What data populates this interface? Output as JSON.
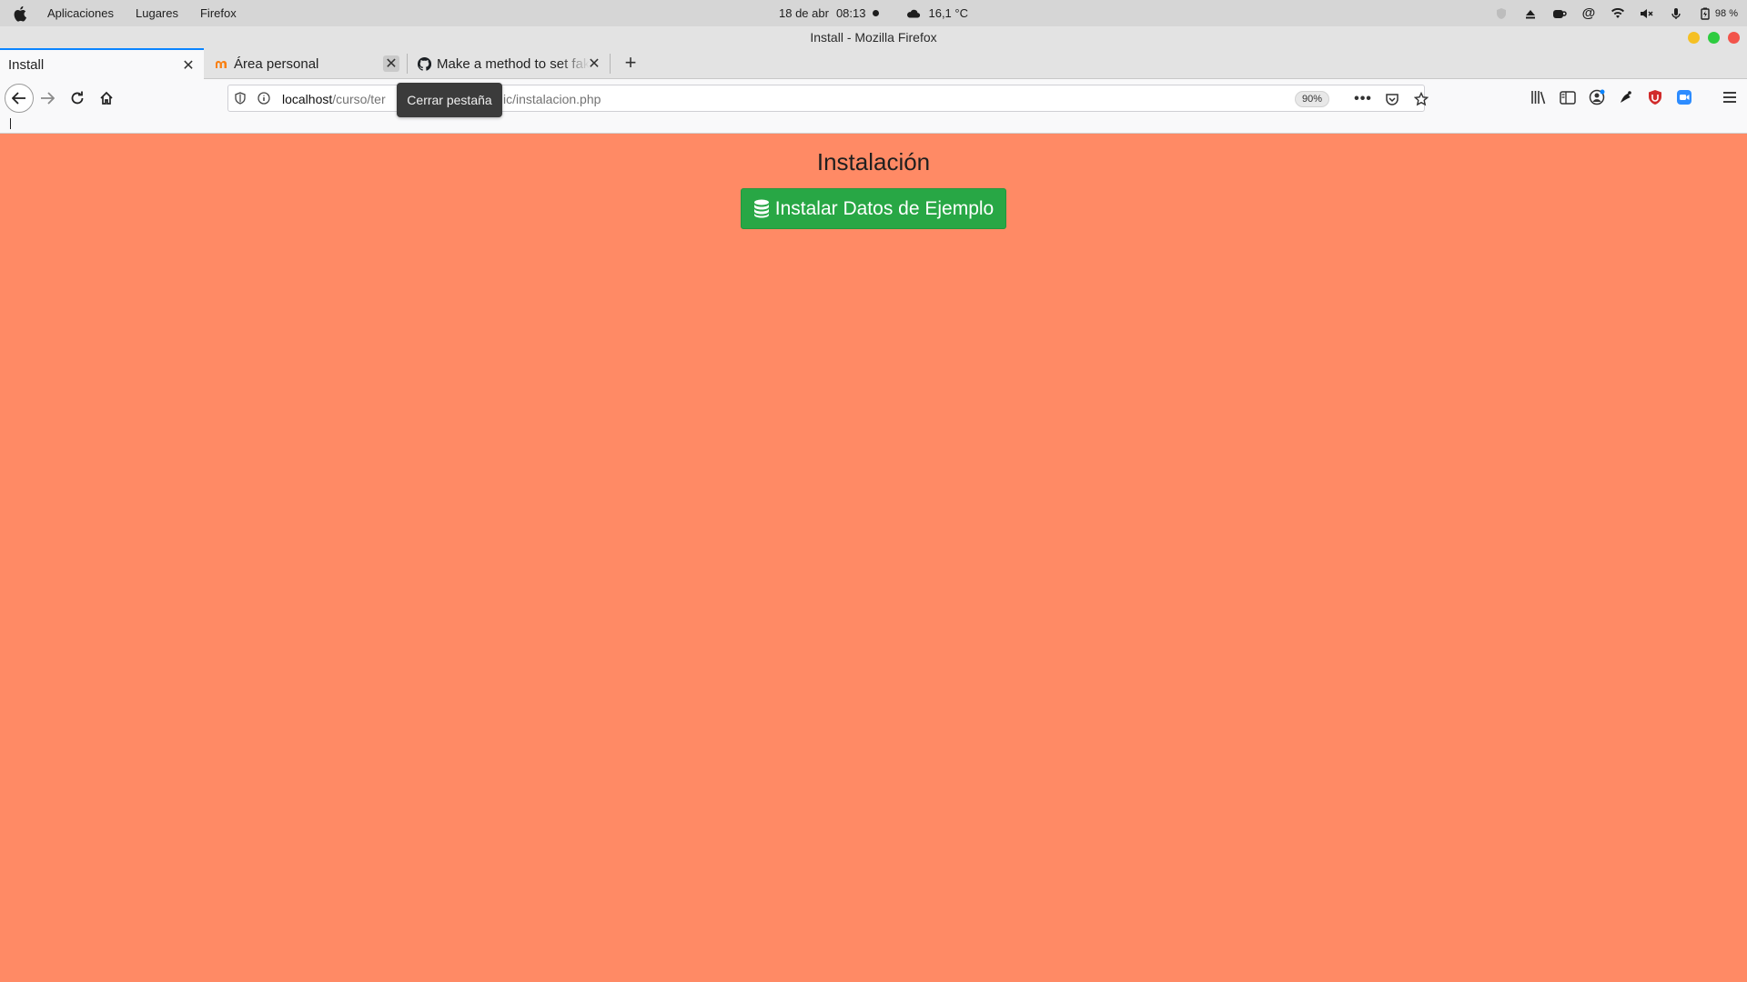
{
  "system_panel": {
    "menu_items": [
      "Aplicaciones",
      "Lugares",
      "Firefox"
    ],
    "date": "18 de abr",
    "time": "08:13",
    "weather": "16,1 °C",
    "battery": "98 %"
  },
  "window": {
    "title": "Install - Mozilla Firefox",
    "controls": {
      "minimize_color": "#f5c024",
      "maximize_color": "#2ecc40",
      "close_color": "#f2544b"
    }
  },
  "tabs": [
    {
      "title": "Install",
      "active": true
    },
    {
      "title": "Área personal",
      "active": false
    },
    {
      "title": "Make a method to set fak",
      "active": false
    }
  ],
  "tooltip": "Cerrar pestaña",
  "urlbar": {
    "host": "localhost",
    "path_start": "/curso/ter",
    "path_end": "ic/instalacion.php",
    "zoom": "90%"
  },
  "page": {
    "heading": "Instalación",
    "install_button_label": "Instalar Datos de Ejemplo",
    "background_color": "#ff8a65",
    "button_color": "#28a745"
  }
}
